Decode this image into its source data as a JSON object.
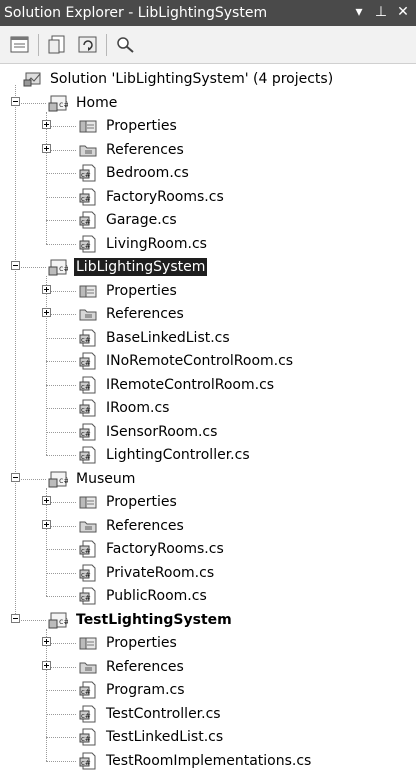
{
  "titlebar": {
    "title": "Solution Explorer - LibLightingSystem",
    "dropdown_glyph": "▾",
    "pin_glyph": "⊥",
    "close_glyph": "✕"
  },
  "toolbar": {
    "buttons": [
      {
        "name": "properties-window-icon"
      },
      {
        "name": "show-all-files-icon"
      },
      {
        "name": "refresh-icon"
      },
      {
        "name": "view-class-diagram-icon"
      }
    ]
  },
  "tree": [
    {
      "type": "solution",
      "text": "Solution 'LibLightingSystem' (4 projects)",
      "level": 0
    },
    {
      "type": "project",
      "text": "Home",
      "level": 1,
      "expander": "minus"
    },
    {
      "type": "properties",
      "text": "Properties",
      "level": 2,
      "expander": "plus"
    },
    {
      "type": "references",
      "text": "References",
      "level": 2,
      "expander": "plus"
    },
    {
      "type": "cs",
      "text": "Bedroom.cs",
      "level": 2
    },
    {
      "type": "cs",
      "text": "FactoryRooms.cs",
      "level": 2
    },
    {
      "type": "cs",
      "text": "Garage.cs",
      "level": 2
    },
    {
      "type": "cs",
      "text": "LivingRoom.cs",
      "level": 2,
      "last": true
    },
    {
      "type": "project",
      "text": "LibLightingSystem",
      "level": 1,
      "expander": "minus",
      "selected": true
    },
    {
      "type": "properties",
      "text": "Properties",
      "level": 2,
      "expander": "plus"
    },
    {
      "type": "references",
      "text": "References",
      "level": 2,
      "expander": "plus"
    },
    {
      "type": "cs",
      "text": "BaseLinkedList.cs",
      "level": 2
    },
    {
      "type": "cs",
      "text": "INoRemoteControlRoom.cs",
      "level": 2
    },
    {
      "type": "cs",
      "text": "IRemoteControlRoom.cs",
      "level": 2
    },
    {
      "type": "cs",
      "text": "IRoom.cs",
      "level": 2
    },
    {
      "type": "cs",
      "text": "ISensorRoom.cs",
      "level": 2
    },
    {
      "type": "cs",
      "text": "LightingController.cs",
      "level": 2,
      "last": true
    },
    {
      "type": "project",
      "text": "Museum",
      "level": 1,
      "expander": "minus"
    },
    {
      "type": "properties",
      "text": "Properties",
      "level": 2,
      "expander": "plus"
    },
    {
      "type": "references",
      "text": "References",
      "level": 2,
      "expander": "plus"
    },
    {
      "type": "cs",
      "text": "FactoryRooms.cs",
      "level": 2
    },
    {
      "type": "cs",
      "text": "PrivateRoom.cs",
      "level": 2
    },
    {
      "type": "cs",
      "text": "PublicRoom.cs",
      "level": 2,
      "last": true
    },
    {
      "type": "project",
      "text": "TestLightingSystem",
      "level": 1,
      "expander": "minus",
      "bold": true,
      "last_project": true
    },
    {
      "type": "properties",
      "text": "Properties",
      "level": 2,
      "expander": "plus"
    },
    {
      "type": "references",
      "text": "References",
      "level": 2,
      "expander": "plus"
    },
    {
      "type": "cs",
      "text": "Program.cs",
      "level": 2
    },
    {
      "type": "cs",
      "text": "TestController.cs",
      "level": 2
    },
    {
      "type": "cs",
      "text": "TestLinkedList.cs",
      "level": 2
    },
    {
      "type": "cs",
      "text": "TestRoomImplementations.cs",
      "level": 2,
      "last": true
    }
  ]
}
